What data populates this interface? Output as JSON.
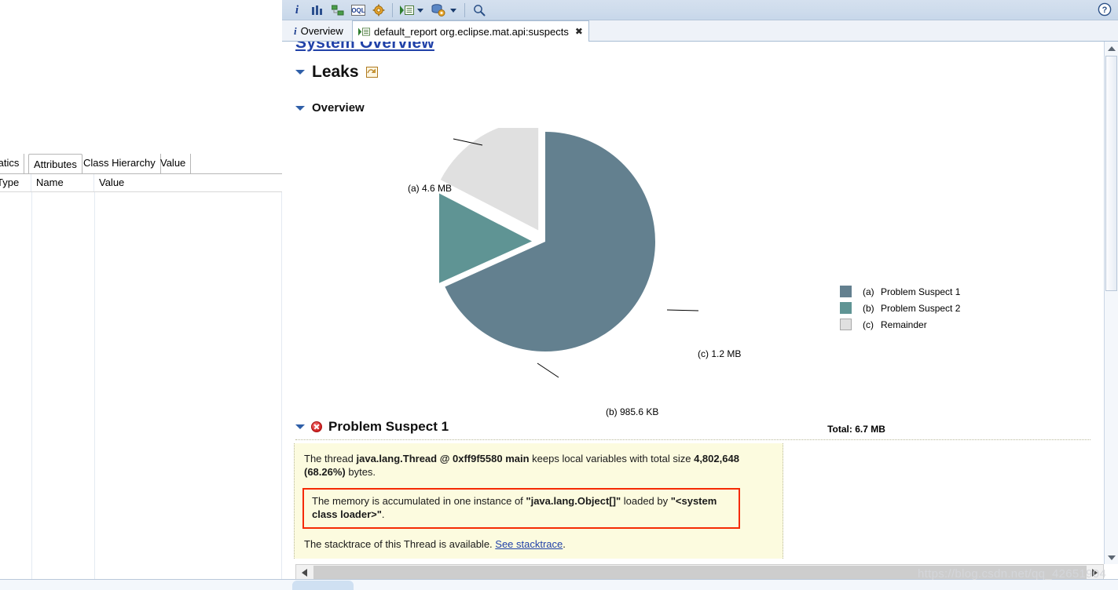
{
  "window": {
    "help_tooltip": "?"
  },
  "toolbar": {
    "items": [
      {
        "name": "overview-info-icon",
        "label": "i"
      },
      {
        "name": "histogram-icon",
        "label": "Histogram"
      },
      {
        "name": "dominator-tree-icon",
        "label": "Dominator Tree"
      },
      {
        "name": "oql-icon",
        "label": "OQL"
      },
      {
        "name": "thread-overview-icon",
        "label": "Thread Overview"
      },
      {
        "name": "run-expert-system-icon",
        "label": "Run Expert System Test"
      },
      {
        "name": "query-browser-icon",
        "label": "Query Browser"
      },
      {
        "name": "search-icon",
        "label": "Find"
      }
    ]
  },
  "editor_tabs": [
    {
      "label": "Overview",
      "icon": "info-icon",
      "active": false,
      "closable": false
    },
    {
      "label": "default_report  org.eclipse.mat.api:suspects",
      "icon": "report-icon",
      "active": true,
      "closable": true,
      "close_label": "✖"
    }
  ],
  "left_pane": {
    "tabs": [
      {
        "label": "tatics",
        "active": false
      },
      {
        "label": "Attributes",
        "active": true
      },
      {
        "label": "Class Hierarchy",
        "active": false
      },
      {
        "label": "Value",
        "active": false
      }
    ],
    "columns": [
      "Type",
      "Name",
      "Value"
    ],
    "pin_icon": "pin-icon"
  },
  "report": {
    "page_title": "System Overview",
    "leaks_heading": "Leaks",
    "leaks_badge_icon": "export-icon",
    "overview_heading": "Overview",
    "suspect_heading": "Problem Suspect 1",
    "suspect_icon": "error-icon",
    "paragraph_1": {
      "part_a": "The thread ",
      "bold_a": "java.lang.Thread @ 0xff9f5580 main",
      "part_b": " keeps local variables with total size ",
      "bold_b": "4,802,648 (68.26%)",
      "part_c": " bytes."
    },
    "highlight": {
      "part_a": "The memory is accumulated in one instance of ",
      "bold_a": "\"java.lang.Object[]\"",
      "part_b": " loaded by ",
      "bold_b": "\"<system class loader>\"",
      "part_c": "."
    },
    "paragraph_3": {
      "part_a": "The stacktrace of this Thread is available. ",
      "link": "See stacktrace",
      "part_b": "."
    }
  },
  "chart_data": {
    "type": "pie",
    "title": "",
    "total_label": "Total: 6.7 MB",
    "slices": [
      {
        "key": "(a)",
        "name": "Problem Suspect 1",
        "label": "(a)  4.6 MB",
        "value_bytes": 4802648,
        "display": "4.6 MB",
        "percent": 68.26,
        "color": "#63808f",
        "exploded": false
      },
      {
        "key": "(b)",
        "name": "Problem Suspect 2",
        "label": "(b)  985.6 KB",
        "value_bytes": 1009254,
        "display": "985.6 KB",
        "percent": 14.34,
        "color": "#5f9494",
        "exploded": true
      },
      {
        "key": "(c)",
        "name": "Remainder",
        "label": "(c)  1.2 MB",
        "value_bytes": 1258291,
        "display": "1.2 MB",
        "percent": 17.4,
        "color": "#e0e0e0",
        "exploded": true
      }
    ],
    "legend": [
      {
        "key": "(a)",
        "text": "Problem Suspect 1",
        "color": "#63808f"
      },
      {
        "key": "(b)",
        "text": "Problem Suspect 2",
        "color": "#5f9494"
      },
      {
        "key": "(c)",
        "text": "Remainder",
        "color": "#e0e0e0"
      }
    ],
    "legend_position": "right"
  },
  "watermark": {
    "text": "https://blog.csdn.net/qq_42651904"
  }
}
